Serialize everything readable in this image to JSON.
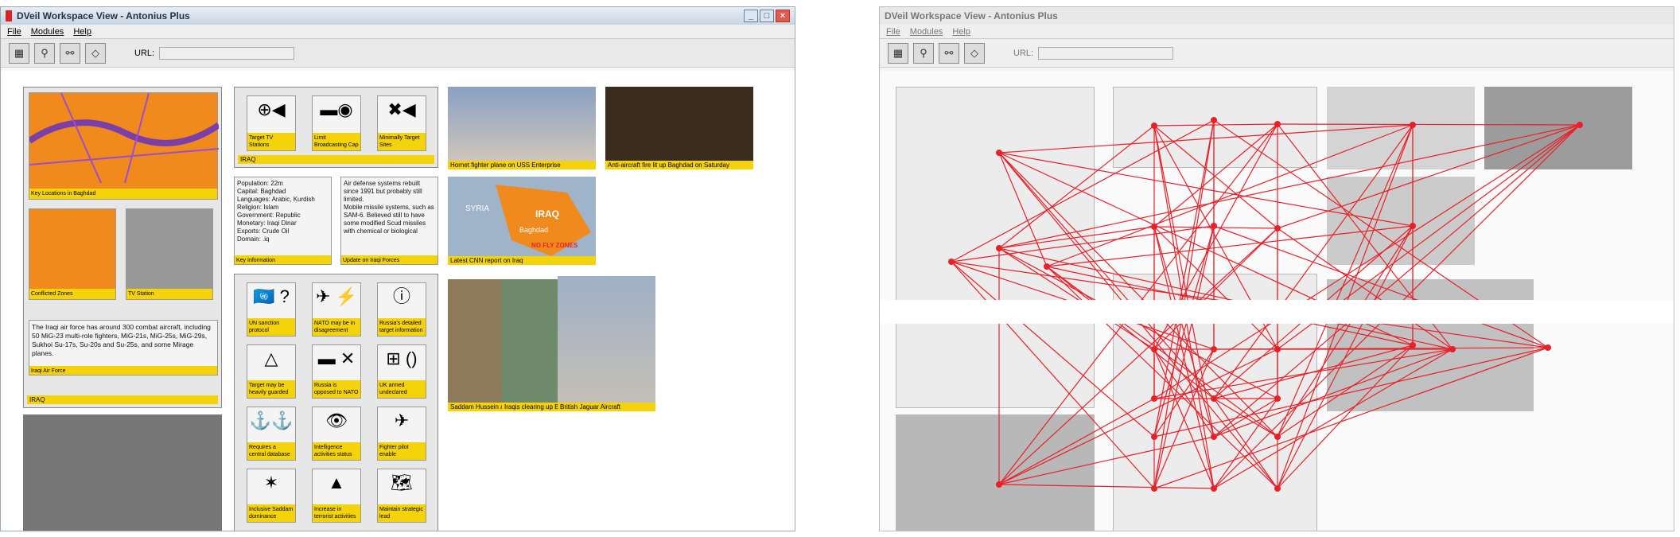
{
  "window": {
    "title": "DVeil Workspace View - Antonius Plus"
  },
  "menu": {
    "file": "File",
    "modules": "Modules",
    "help": "Help"
  },
  "toolbar": {
    "url_label": "URL:"
  },
  "panels": {
    "map_panel": {
      "label": "IRAQ"
    },
    "map_top": {
      "caption": "Key Locations in Baghdad"
    },
    "map_iraq": {
      "caption": "Conflicted Zones"
    },
    "tv_station": {
      "caption": "TV Station"
    },
    "air_force_text": "The Iraqi air force has around 300 combat aircraft, including 50 MiG-23 multi-role fighters, MiG-21s, MiG-25s, MiG-29s, Sukhoi Su-17s, Su-20s and Su-25s, and some Mirage planes.",
    "air_force_caption": "Iraqi Air Force"
  },
  "icons_panel": {
    "label": "IRAQ",
    "items": [
      {
        "glyph": "⊕◀",
        "caption": "Target TV Stations"
      },
      {
        "glyph": "▬◉",
        "caption": "Limit Broadcasting Cap"
      },
      {
        "glyph": "✖◀",
        "caption": "Minimally Target Sites"
      }
    ]
  },
  "info_text": "Population: 22m\nCapital: Baghdad\nLanguages: Arabic, Kurdish\nReligion: Islam\nGovernment: Republic\nMonetary: Iraqi Dinar\nExports: Crude Oil\nDomain: .iq",
  "info_caption": "Key Information",
  "defense_text": "Air defense systems rebuilt since 1991 but probably still limited.\nMobile missile systems, such as SAM-6. Believed still to have some modified Scud missiles with chemical or biological",
  "defense_caption": "Update on Iraqi Forces",
  "photos": {
    "fighter": "Hornet fighter plane on USS Enterprise",
    "night": "Anti-aircraft fire lit up Baghdad on Saturday",
    "nofly": "Latest CNN report on Iraq",
    "syria": "SYRIA",
    "iraq": "IRAQ",
    "baghdad": "Baghdad",
    "nofly_label": "NO FLY ZONES"
  },
  "collage": {
    "c1": "Saddam Hussein a",
    "c2": "Iraqis clearing up B",
    "c3": "British Jaguar Aircraft"
  },
  "grid": [
    {
      "glyph": "🇺🇳 ?",
      "caption": "UN sanction protocol"
    },
    {
      "glyph": "✈ ⚡",
      "caption": "NATO may be in disagreement"
    },
    {
      "glyph": "ⓘ",
      "caption": "Russia's detailed target information"
    },
    {
      "glyph": "△",
      "caption": "Target may be heavily guarded"
    },
    {
      "glyph": "▬ ✕",
      "caption": "Russia is opposed to NATO"
    },
    {
      "glyph": "⊞ ()",
      "caption": "UK armed undeclared"
    },
    {
      "glyph": "⚓⚓",
      "caption": "Requires a central database"
    },
    {
      "glyph": "👁",
      "caption": "Intelligence activities status"
    },
    {
      "glyph": "✈",
      "caption": "Fighter pilot enable maneuvers"
    },
    {
      "glyph": "✶",
      "caption": "Inclusive Saddam dominance"
    },
    {
      "glyph": "▲",
      "caption": "Increase in terrorist activities"
    },
    {
      "glyph": "🗺",
      "caption": "Maintain strategic lead"
    }
  ],
  "colors": {
    "accent": "#f5d30b",
    "network": "#e8202a",
    "map_orange": "#f08a1c"
  }
}
